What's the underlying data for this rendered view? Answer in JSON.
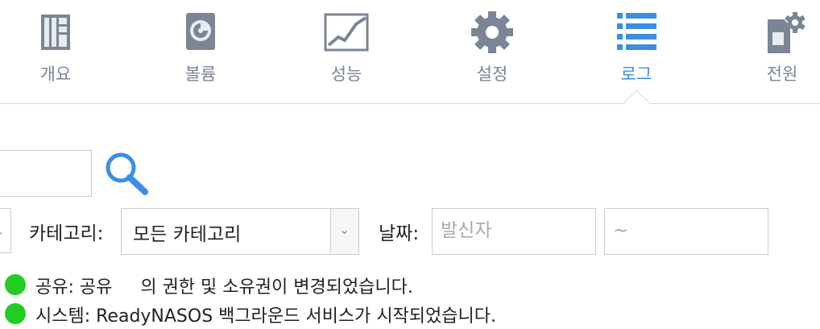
{
  "nav": {
    "items": [
      {
        "label": "개요",
        "icon": "overview-icon"
      },
      {
        "label": "볼륨",
        "icon": "volume-icon"
      },
      {
        "label": "성능",
        "icon": "performance-icon"
      },
      {
        "label": "설정",
        "icon": "gear-icon"
      },
      {
        "label": "로그",
        "icon": "list-icon",
        "active": true
      },
      {
        "label": "전원",
        "icon": "power-settings-icon"
      }
    ]
  },
  "filters": {
    "category_label": "카테고리:",
    "category_value": "모든 카테고리",
    "date_label": "날짜:",
    "date_from_placeholder": "발신자",
    "date_to_placeholder": "~"
  },
  "logs": [
    {
      "text": "공유: 공유     의 권한 및 소유권이 변경되었습니다.",
      "status_color": "#22cc22"
    },
    {
      "text": "시스템: ReadyNASOS 백그라운드 서비스가 시작되었습니다.",
      "status_color": "#22cc22"
    }
  ]
}
